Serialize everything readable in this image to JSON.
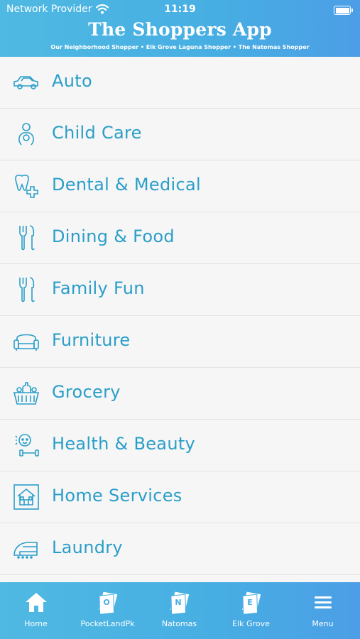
{
  "status_bar": {
    "carrier": "Network Provider",
    "time": "11:19"
  },
  "header": {
    "title": "The Shoppers App",
    "subtitle": "Our Neighborhood Shopper • Elk Grove Laguna Shopper • The Natomas Shopper"
  },
  "categories": [
    {
      "label": "Auto",
      "icon": "car-icon"
    },
    {
      "label": "Child Care",
      "icon": "baby-icon"
    },
    {
      "label": "Dental & Medical",
      "icon": "tooth-icon"
    },
    {
      "label": "Dining & Food",
      "icon": "fork-knife-icon"
    },
    {
      "label": "Family Fun",
      "icon": "fork-knife-icon"
    },
    {
      "label": "Furniture",
      "icon": "sofa-icon"
    },
    {
      "label": "Grocery",
      "icon": "basket-icon"
    },
    {
      "label": "Health & Beauty",
      "icon": "fitness-icon"
    },
    {
      "label": "Home Services",
      "icon": "house-icon"
    },
    {
      "label": "Laundry",
      "icon": "iron-icon"
    }
  ],
  "tabs": [
    {
      "label": "Home",
      "icon": "home-icon"
    },
    {
      "label": "PocketLandPk",
      "icon": "newspaper-icon"
    },
    {
      "label": "Natomas",
      "icon": "newspaper-icon"
    },
    {
      "label": "Elk Grove",
      "icon": "newspaper-icon"
    },
    {
      "label": "Menu",
      "icon": "hamburger-icon"
    }
  ],
  "colors": {
    "accent": "#2a9ec9",
    "header": "#47aee3",
    "background": "#f6f6f6"
  }
}
